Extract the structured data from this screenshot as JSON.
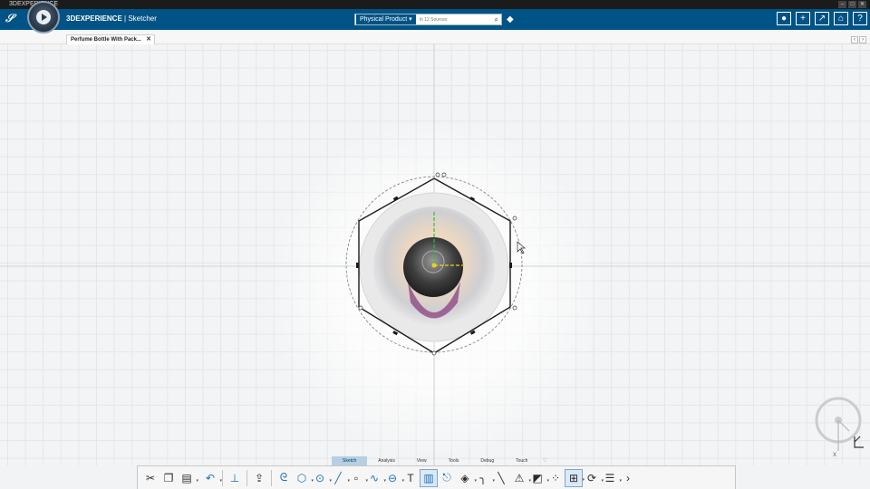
{
  "window": {
    "title": "3DEXPERIENCE"
  },
  "header": {
    "brand": "3DEXPERIENCE",
    "separator": "|",
    "app_name": "Sketcher",
    "search": {
      "scope": "Physical Product",
      "placeholder": "In 12 Sources"
    }
  },
  "document_tab": {
    "label": "Perfume Bottle With Pack..."
  },
  "command_tabs": [
    "Sketch",
    "Analysis",
    "View",
    "Tools",
    "Debug",
    "Touch"
  ],
  "active_command_tab": "Sketch",
  "colors": {
    "header": "#005386",
    "accent": "#1d6fb8",
    "sketch_line": "#1a1a1a",
    "axis_green": "#2fbf2f",
    "axis_yellow": "#e8d21a"
  },
  "icons": {
    "header_right": [
      "user-icon",
      "add-icon",
      "share-icon",
      "home-icon",
      "help-icon"
    ],
    "toolbar": [
      "cut-icon",
      "copy-icon",
      "paste-icon",
      "undo-icon",
      "compass-icon",
      "export-icon",
      "spline-icon",
      "polygon-icon",
      "circle-icon",
      "line-icon",
      "point-icon",
      "curve-icon",
      "slot-icon",
      "text-icon",
      "constraint-icon",
      "project-icon",
      "trim-icon",
      "corner-icon",
      "chamfer-icon",
      "mirror-icon",
      "offset-icon",
      "pattern-icon",
      "dimension-icon",
      "transform-icon",
      "display-icon",
      "next-icon"
    ]
  }
}
